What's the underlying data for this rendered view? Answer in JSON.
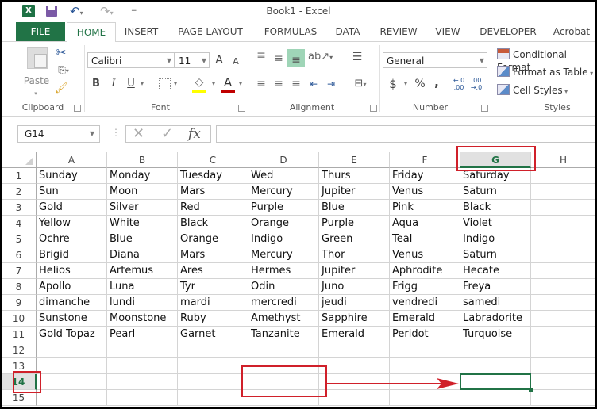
{
  "window": {
    "title": "Book1 - Excel",
    "app_icon": "excel-logo-icon",
    "app_icon_text": "X"
  },
  "quick_access": {
    "save": "save-icon",
    "undo": "undo-icon",
    "redo": "redo-icon",
    "customize": "customize-qat-icon"
  },
  "tabs": [
    {
      "label": "FILE"
    },
    {
      "label": "HOME"
    },
    {
      "label": "INSERT"
    },
    {
      "label": "PAGE LAYOUT"
    },
    {
      "label": "FORMULAS"
    },
    {
      "label": "DATA"
    },
    {
      "label": "REVIEW"
    },
    {
      "label": "VIEW"
    },
    {
      "label": "DEVELOPER"
    },
    {
      "label": "Acrobat"
    }
  ],
  "active_tab": "HOME",
  "ribbon": {
    "clipboard": {
      "label": "Clipboard",
      "paste": "Paste"
    },
    "font": {
      "label": "Font",
      "font_name": "Calibri",
      "font_size": "11",
      "bold": "B",
      "italic": "I",
      "underline": "U",
      "grow": "A",
      "shrink": "A",
      "font_color": "A",
      "fill_color_hex": "#ffff00",
      "font_color_hex": "#c00000"
    },
    "alignment": {
      "label": "Alignment"
    },
    "number": {
      "label": "Number",
      "format": "General",
      "currency": "$",
      "percent": "%",
      "comma": ",",
      "inc_decimal": "←.0 .00",
      "dec_decimal": ".00 →.0"
    },
    "styles": {
      "label": "Styles",
      "conditional": "Conditional Format",
      "format_table": "Format as Table",
      "cell_styles": "Cell Styles"
    }
  },
  "formula_bar": {
    "name_box": "G14",
    "cancel": "✕",
    "enter": "✓",
    "fx": "fx",
    "value": ""
  },
  "sheet": {
    "columns": [
      "A",
      "B",
      "C",
      "D",
      "E",
      "F",
      "G",
      "H"
    ],
    "selected_column": "G",
    "selected_row": "14",
    "active_cell": "G14",
    "rows": [
      {
        "n": "1",
        "cells": [
          "Sunday",
          "Monday",
          "Tuesday",
          "Wed",
          "Thurs",
          "Friday",
          "Saturday",
          ""
        ]
      },
      {
        "n": "2",
        "cells": [
          "Sun",
          "Moon",
          "Mars",
          "Mercury",
          "Jupiter",
          "Venus",
          "Saturn",
          ""
        ]
      },
      {
        "n": "3",
        "cells": [
          "Gold",
          "Silver",
          "Red",
          "Purple",
          "Blue",
          "Pink",
          "Black",
          ""
        ]
      },
      {
        "n": "4",
        "cells": [
          "Yellow",
          "White",
          "Black",
          "Orange",
          "Purple",
          "Aqua",
          "Violet",
          ""
        ]
      },
      {
        "n": "5",
        "cells": [
          "Ochre",
          "Blue",
          "Orange",
          "Indigo",
          "Green",
          "Teal",
          "Indigo",
          ""
        ]
      },
      {
        "n": "6",
        "cells": [
          "Brigid",
          "Diana",
          "Mars",
          "Mercury",
          "Thor",
          "Venus",
          "Saturn",
          ""
        ]
      },
      {
        "n": "7",
        "cells": [
          "Helios",
          "Artemus",
          "Ares",
          "Hermes",
          "Jupiter",
          "Aphrodite",
          "Hecate",
          ""
        ]
      },
      {
        "n": "8",
        "cells": [
          "Apollo",
          "Luna",
          "Tyr",
          "Odin",
          "Juno",
          "Frigg",
          "Freya",
          ""
        ]
      },
      {
        "n": "9",
        "cells": [
          "dimanche",
          "lundi",
          "mardi",
          "mercredi",
          "jeudi",
          "vendredi",
          "samedi",
          ""
        ]
      },
      {
        "n": "10",
        "cells": [
          "Sunstone",
          "Moonstone",
          "Ruby",
          "Amethyst",
          "Sapphire",
          "Emerald",
          "Labradorite",
          ""
        ]
      },
      {
        "n": "11",
        "cells": [
          "Gold Topaz",
          "Pearl",
          "Garnet",
          "Tanzanite",
          "Emerald",
          "Peridot",
          "Turquoise",
          ""
        ]
      },
      {
        "n": "12",
        "cells": [
          "",
          "",
          "",
          "",
          "",
          "",
          "",
          ""
        ]
      },
      {
        "n": "13",
        "cells": [
          "",
          "",
          "",
          "",
          "",
          "",
          "",
          ""
        ]
      },
      {
        "n": "14",
        "cells": [
          "",
          "",
          "",
          "",
          "",
          "",
          "",
          ""
        ]
      },
      {
        "n": "15",
        "cells": [
          "",
          "",
          "",
          "",
          "",
          "",
          "",
          ""
        ]
      }
    ]
  },
  "annotations": {
    "highlight_color": "#d0202a",
    "active_color": "#217346"
  }
}
